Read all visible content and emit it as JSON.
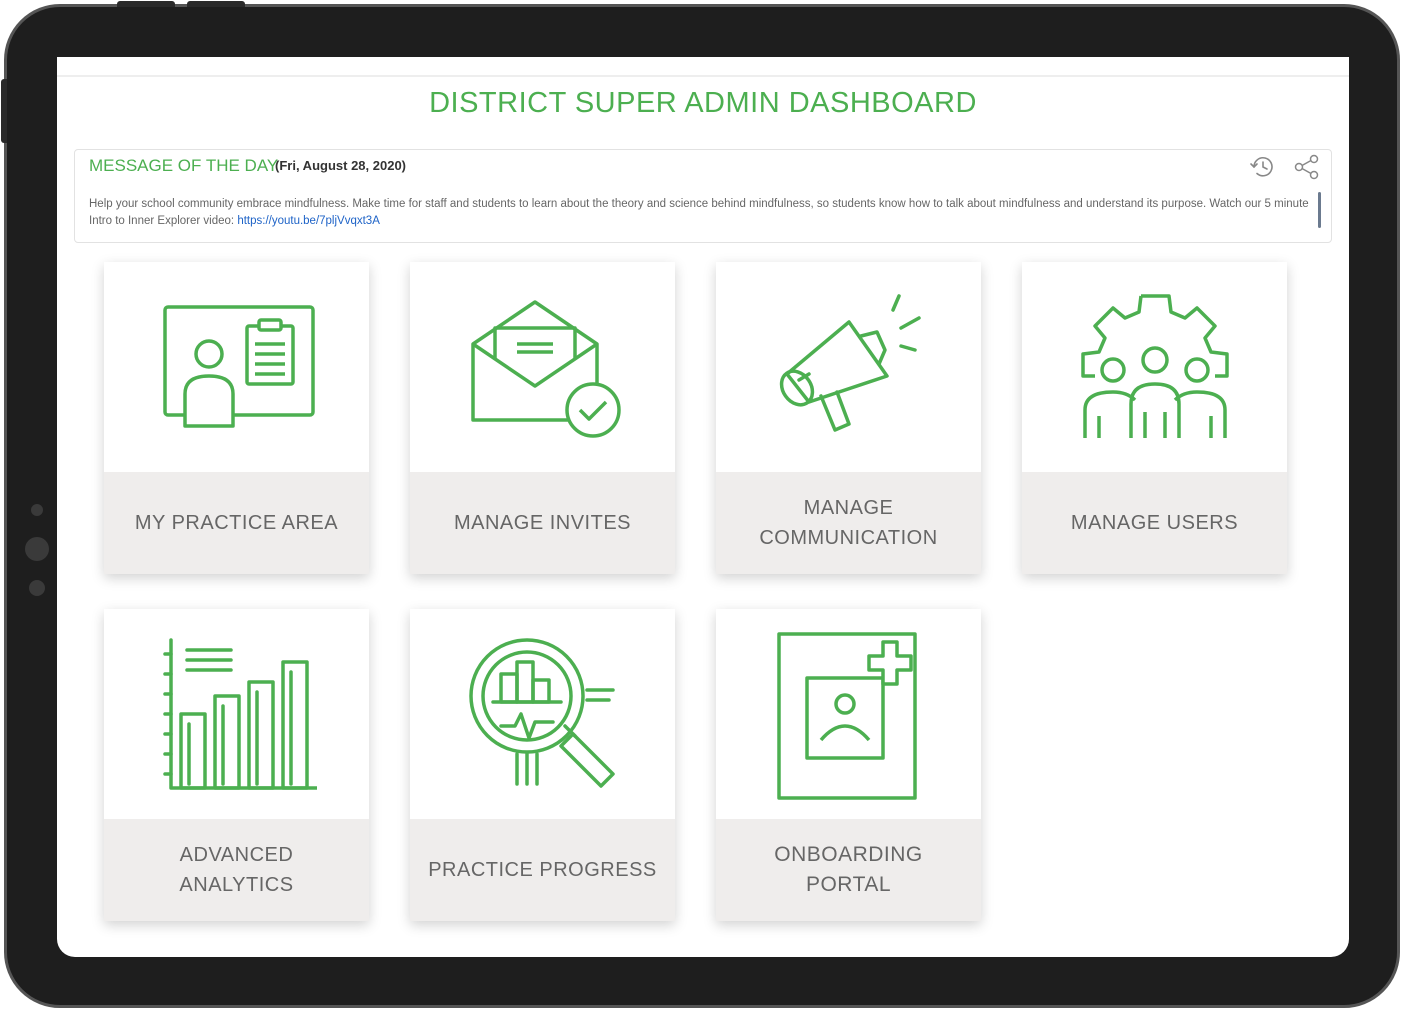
{
  "page": {
    "title": "DISTRICT SUPER ADMIN DASHBOARD"
  },
  "motd": {
    "label": "MESSAGE OF THE DAY",
    "date": "(Fri, August 28, 2020)",
    "text": "Help your school community embrace mindfulness. Make time for staff and students to learn about the theory and science behind mindfulness, so students know how to talk about mindfulness and understand its purpose. Watch our 5 minute Intro to Inner Explorer video: ",
    "link": "https://youtu.be/7pljVvqxt3A",
    "icons": [
      "history-icon",
      "share-icon"
    ]
  },
  "cards": [
    {
      "label": "MY PRACTICE AREA",
      "icon": "presenter-board-icon"
    },
    {
      "label": "MANAGE INVITES",
      "icon": "envelope-check-icon"
    },
    {
      "label": "MANAGE COMMUNICATION",
      "icon": "megaphone-icon"
    },
    {
      "label": "MANAGE USERS",
      "icon": "users-gear-icon"
    },
    {
      "label": "ADVANCED ANALYTICS",
      "icon": "bar-chart-icon"
    },
    {
      "label": "PRACTICE PROGRESS",
      "icon": "magnifier-chart-icon"
    },
    {
      "label": "ONBOARDING PORTAL",
      "icon": "add-profile-icon"
    }
  ],
  "colors": {
    "accent": "#4caf50",
    "card_label_bg": "#efedec",
    "link": "#1e63c7",
    "bezel": "#1e1e1e"
  }
}
